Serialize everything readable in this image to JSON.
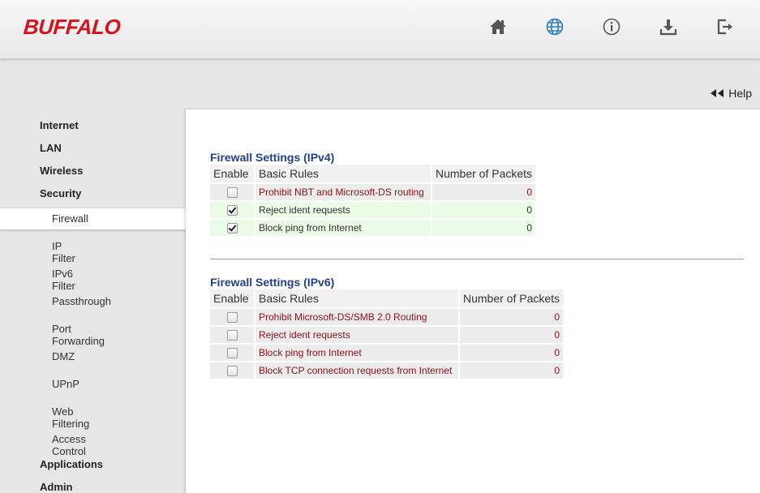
{
  "brand": "BUFFALO",
  "header_icons": [
    "home-icon",
    "globe-icon",
    "info-icon",
    "download-icon",
    "logout-icon"
  ],
  "colors": {
    "brand_red": "#d7111e",
    "title_blue": "#23408e",
    "rule_red": "#8e0f17",
    "enabled_green": "#eafbe6"
  },
  "help": {
    "label": "Help"
  },
  "nav": {
    "categories": {
      "internet": "Internet",
      "lan": "LAN",
      "wireless": "Wireless",
      "security": "Security",
      "applications": "Applications",
      "admin": "Admin"
    },
    "security_items": [
      "Firewall",
      "IP Filter",
      "IPv6 Filter",
      "Passthrough",
      "Port Forwarding",
      "DMZ",
      "UPnP",
      "Web Filtering",
      "Access Control"
    ],
    "selected": "Firewall"
  },
  "ipv4": {
    "title": "Firewall Settings (IPv4)",
    "headers": [
      "Enable",
      "Basic Rules",
      "Number of Packets"
    ],
    "rows": [
      {
        "rule": "Prohibit NBT and Microsoft-DS routing",
        "packets": "0",
        "enabled": false
      },
      {
        "rule": "Reject ident requests",
        "packets": "0",
        "enabled": true
      },
      {
        "rule": "Block ping from Internet",
        "packets": "0",
        "enabled": true
      }
    ]
  },
  "ipv6": {
    "title": "Firewall Settings (IPv6)",
    "headers": [
      "Enable",
      "Basic Rules",
      "Number of Packets"
    ],
    "rows": [
      {
        "rule": "Prohibit Microsoft-DS/SMB 2.0 Routing",
        "packets": "0",
        "enabled": false
      },
      {
        "rule": "Reject ident requests",
        "packets": "0",
        "enabled": false
      },
      {
        "rule": "Block ping from Internet",
        "packets": "0",
        "enabled": false
      },
      {
        "rule": "Block TCP connection requests from Internet",
        "packets": "0",
        "enabled": false
      }
    ]
  }
}
